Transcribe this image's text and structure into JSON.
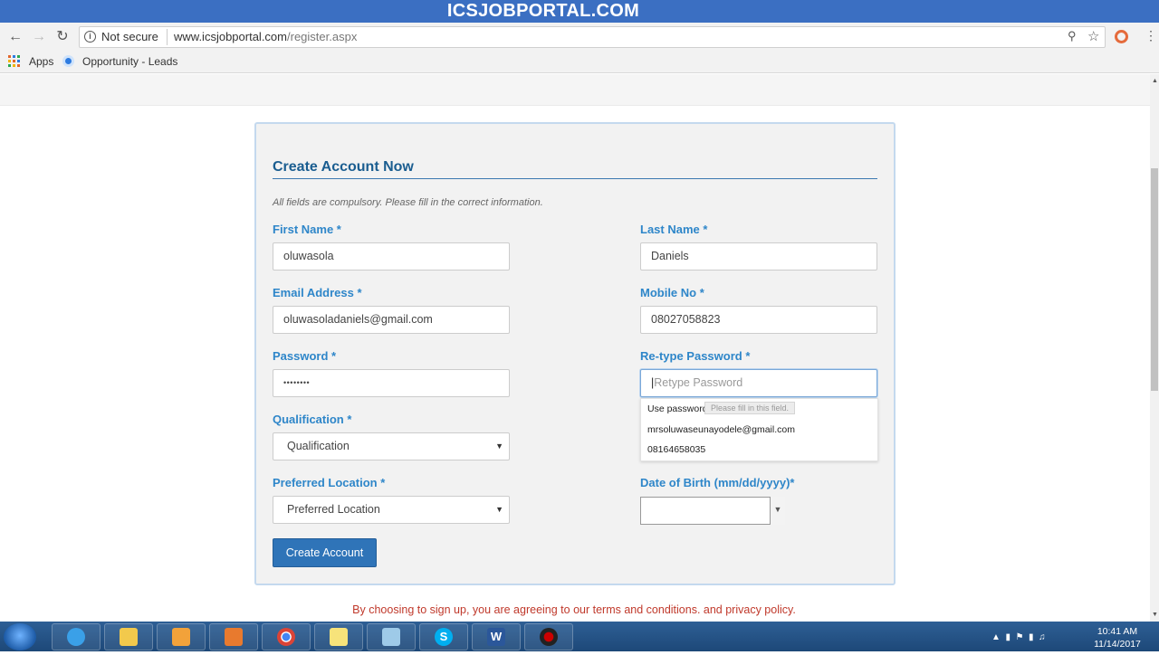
{
  "banner": {
    "title": "ICSJOBPORTAL.COM"
  },
  "browser": {
    "security": "Not secure",
    "url_domain": "www.icsjobportal.com",
    "url_path": "/register.aspx",
    "bookmarks": {
      "apps": "Apps",
      "opportunity": "Opportunity - Leads"
    }
  },
  "form": {
    "title": "Create Account Now",
    "note": "All fields are compulsory. Please fill in the correct information.",
    "first_name": {
      "label": "First Name *",
      "value": "oluwasola"
    },
    "last_name": {
      "label": "Last Name *",
      "value": "Daniels"
    },
    "email": {
      "label": "Email Address *",
      "value": "oluwasoladaniels@gmail.com"
    },
    "mobile": {
      "label": "Mobile No *",
      "value": "08027058823"
    },
    "password": {
      "label": "Password *",
      "value": "••••••••"
    },
    "retype_password": {
      "label": "Re-type Password *",
      "placeholder": "Retype Password"
    },
    "qualification": {
      "label": "Qualification *",
      "selected": "Qualification"
    },
    "preferred_location": {
      "label": "Preferred Location *",
      "selected": "Preferred Location"
    },
    "dob": {
      "label": "Date of Birth (mm/dd/yyyy)*",
      "value": ""
    },
    "submit_label": "Create Account",
    "terms": "By choosing to sign up, you are agreeing to our terms and conditions. and privacy policy."
  },
  "autofill": {
    "header": "Use password for:",
    "tooltip": "Please fill in this field.",
    "options": [
      "mrsoluwaseunayodele@gmail.com",
      "08164658035"
    ]
  },
  "taskbar": {
    "apps": [
      "internet-explorer",
      "file-explorer",
      "outlook",
      "media-player",
      "chrome",
      "sticky-notes",
      "app",
      "skype",
      "word",
      "recorder"
    ],
    "clock_time": "10:41 AM",
    "clock_date": "11/14/2017"
  }
}
